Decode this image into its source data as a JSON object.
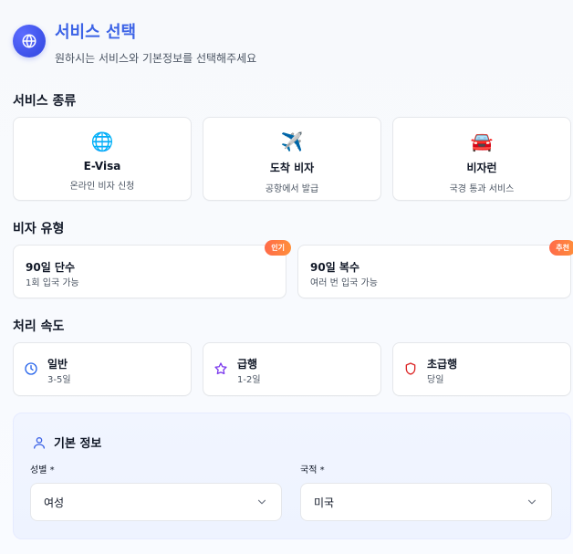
{
  "header": {
    "title": "서비스 선택",
    "subtitle": "원하시는 서비스와 기본정보를 선택해주세요",
    "icon": "globe-icon"
  },
  "sections": {
    "service_kinds_title": "서비스 종류",
    "visa_types_title": "비자 유형",
    "speed_title": "처리 속도"
  },
  "services": [
    {
      "name": "E-Visa",
      "desc": "온라인 비자 신청",
      "icon": "globe-icon",
      "emoji": "🌐"
    },
    {
      "name": "도착 비자",
      "desc": "공항에서 발급",
      "icon": "airplane-icon",
      "emoji": "✈️"
    },
    {
      "name": "비자런",
      "desc": "국경 통과 서비스",
      "icon": "car-icon",
      "emoji": "🚘"
    }
  ],
  "visa_types": [
    {
      "name": "90일 단수",
      "desc": "1회 입국 가능",
      "badge": "인기"
    },
    {
      "name": "90일 복수",
      "desc": "여러 번 입국 가능",
      "badge": "추천"
    }
  ],
  "speeds": [
    {
      "name": "일반",
      "desc": "3-5일",
      "icon": "clock-icon",
      "color": "#2563eb"
    },
    {
      "name": "급행",
      "desc": "1-2일",
      "icon": "star-icon",
      "color": "#7c3aed"
    },
    {
      "name": "초급행",
      "desc": "당일",
      "icon": "shield-icon",
      "color": "#dc2626"
    }
  ],
  "basic_info": {
    "title": "기본 정보",
    "gender_label": "성별 *",
    "gender_value": "여성",
    "nationality_label": "국적 *",
    "nationality_value": "미국",
    "icon": "user-icon"
  },
  "colors": {
    "accent": "#3c63e6",
    "badge_gradient_start": "#ff6b4a",
    "badge_gradient_end": "#ff8f3a"
  }
}
